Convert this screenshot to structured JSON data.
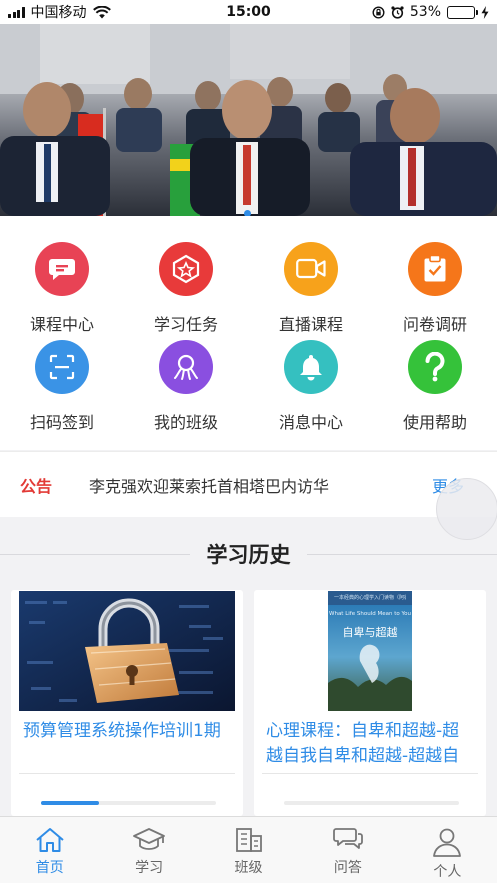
{
  "status_bar": {
    "carrier": "中国移动",
    "time": "15:00",
    "battery": "53%",
    "battery_level": 0.53
  },
  "banner": {
    "slide_count": 1
  },
  "grid": [
    {
      "label": "课程中心",
      "icon": "chat-bubble-icon",
      "color": "#e84355"
    },
    {
      "label": "学习任务",
      "icon": "star-badge-icon",
      "color": "#e83a3a"
    },
    {
      "label": "直播课程",
      "icon": "video-camera-icon",
      "color": "#f7a21b"
    },
    {
      "label": "问卷调研",
      "icon": "clipboard-check-icon",
      "color": "#f5761a"
    },
    {
      "label": "扫码签到",
      "icon": "scan-icon",
      "color": "#3a93e6"
    },
    {
      "label": "我的班级",
      "icon": "class-group-icon",
      "color": "#8a4fe0"
    },
    {
      "label": "消息中心",
      "icon": "bell-icon",
      "color": "#35c0c0"
    },
    {
      "label": "使用帮助",
      "icon": "question-mark-icon",
      "color": "#35c23a"
    }
  ],
  "notice": {
    "tag": "公告",
    "text": "李克强欢迎莱索托首相塔巴内访华",
    "more": "更多"
  },
  "history": {
    "title": "学习历史",
    "cards": [
      {
        "title": "预算管理系统操作培训1期",
        "progress": 0.33
      },
      {
        "title": "心理课程：自卑和超越-超越自我自卑和超越-超越自我",
        "progress": 0.0,
        "book": {
          "top_line": "一本经典的心理学入门读物（阿德勒著作精选）",
          "subtitle": "What Life Should Mean to You",
          "title": "自卑与超越"
        }
      }
    ]
  },
  "tabbar": [
    {
      "label": "首页",
      "icon": "home-icon",
      "active": true
    },
    {
      "label": "学习",
      "icon": "graduation-cap-icon",
      "active": false
    },
    {
      "label": "班级",
      "icon": "building-icon",
      "active": false
    },
    {
      "label": "问答",
      "icon": "qa-bubbles-icon",
      "active": false
    },
    {
      "label": "个人",
      "icon": "person-icon",
      "active": false
    }
  ],
  "colors": {
    "accent": "#2f8ce6",
    "notice_red": "#e23a36"
  }
}
